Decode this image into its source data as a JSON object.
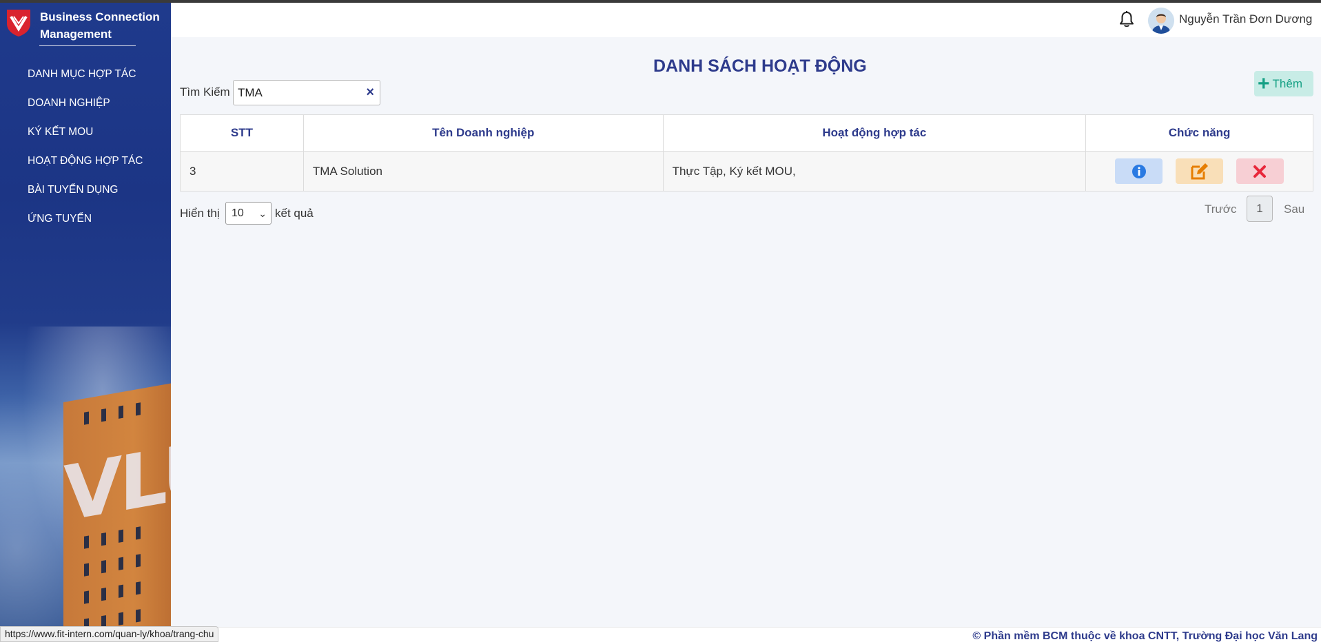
{
  "app": {
    "brand_line1": "Business Connection",
    "brand_line2": "Management"
  },
  "sidebar": {
    "items": [
      {
        "label": "DANH MỤC HỢP TÁC"
      },
      {
        "label": "DOANH NGHIỆP"
      },
      {
        "label": "KÝ KẾT MOU"
      },
      {
        "label": "HOẠT ĐỘNG HỢP TÁC"
      },
      {
        "label": "BÀI TUYỂN DỤNG"
      },
      {
        "label": "ỨNG TUYỂN"
      }
    ],
    "background_text": "VLU"
  },
  "header": {
    "username": "Nguyễn Trần Đơn Dương",
    "bell_icon": "bell-icon",
    "avatar_icon": "user-avatar"
  },
  "page": {
    "title": "DANH SÁCH HOẠT ĐỘNG",
    "add_label": "Thêm",
    "search_label": "Tìm Kiếm",
    "search_value": "TMA"
  },
  "table": {
    "headers": [
      "STT",
      "Tên Doanh nghiệp",
      "Hoạt động hợp tác",
      "Chức năng"
    ],
    "rows": [
      {
        "stt": "3",
        "name": "TMA Solution",
        "activities": "Thực Tập, Ký kết MOU,"
      }
    ]
  },
  "pagination": {
    "show_label": "Hiển thị",
    "page_size": "10",
    "suffix": "kết quả",
    "prev": "Trước",
    "current": "1",
    "next": "Sau"
  },
  "footer": {
    "text": "© Phần mềm BCM thuộc về khoa CNTT, Trường Đại học Văn Lang"
  },
  "statusbar": {
    "url": "https://www.fit-intern.com/quan-ly/khoa/trang-chu"
  },
  "colors": {
    "primary": "#2e3b8c",
    "sidebar": "#1f3a8c",
    "add_button": "#16a085"
  }
}
